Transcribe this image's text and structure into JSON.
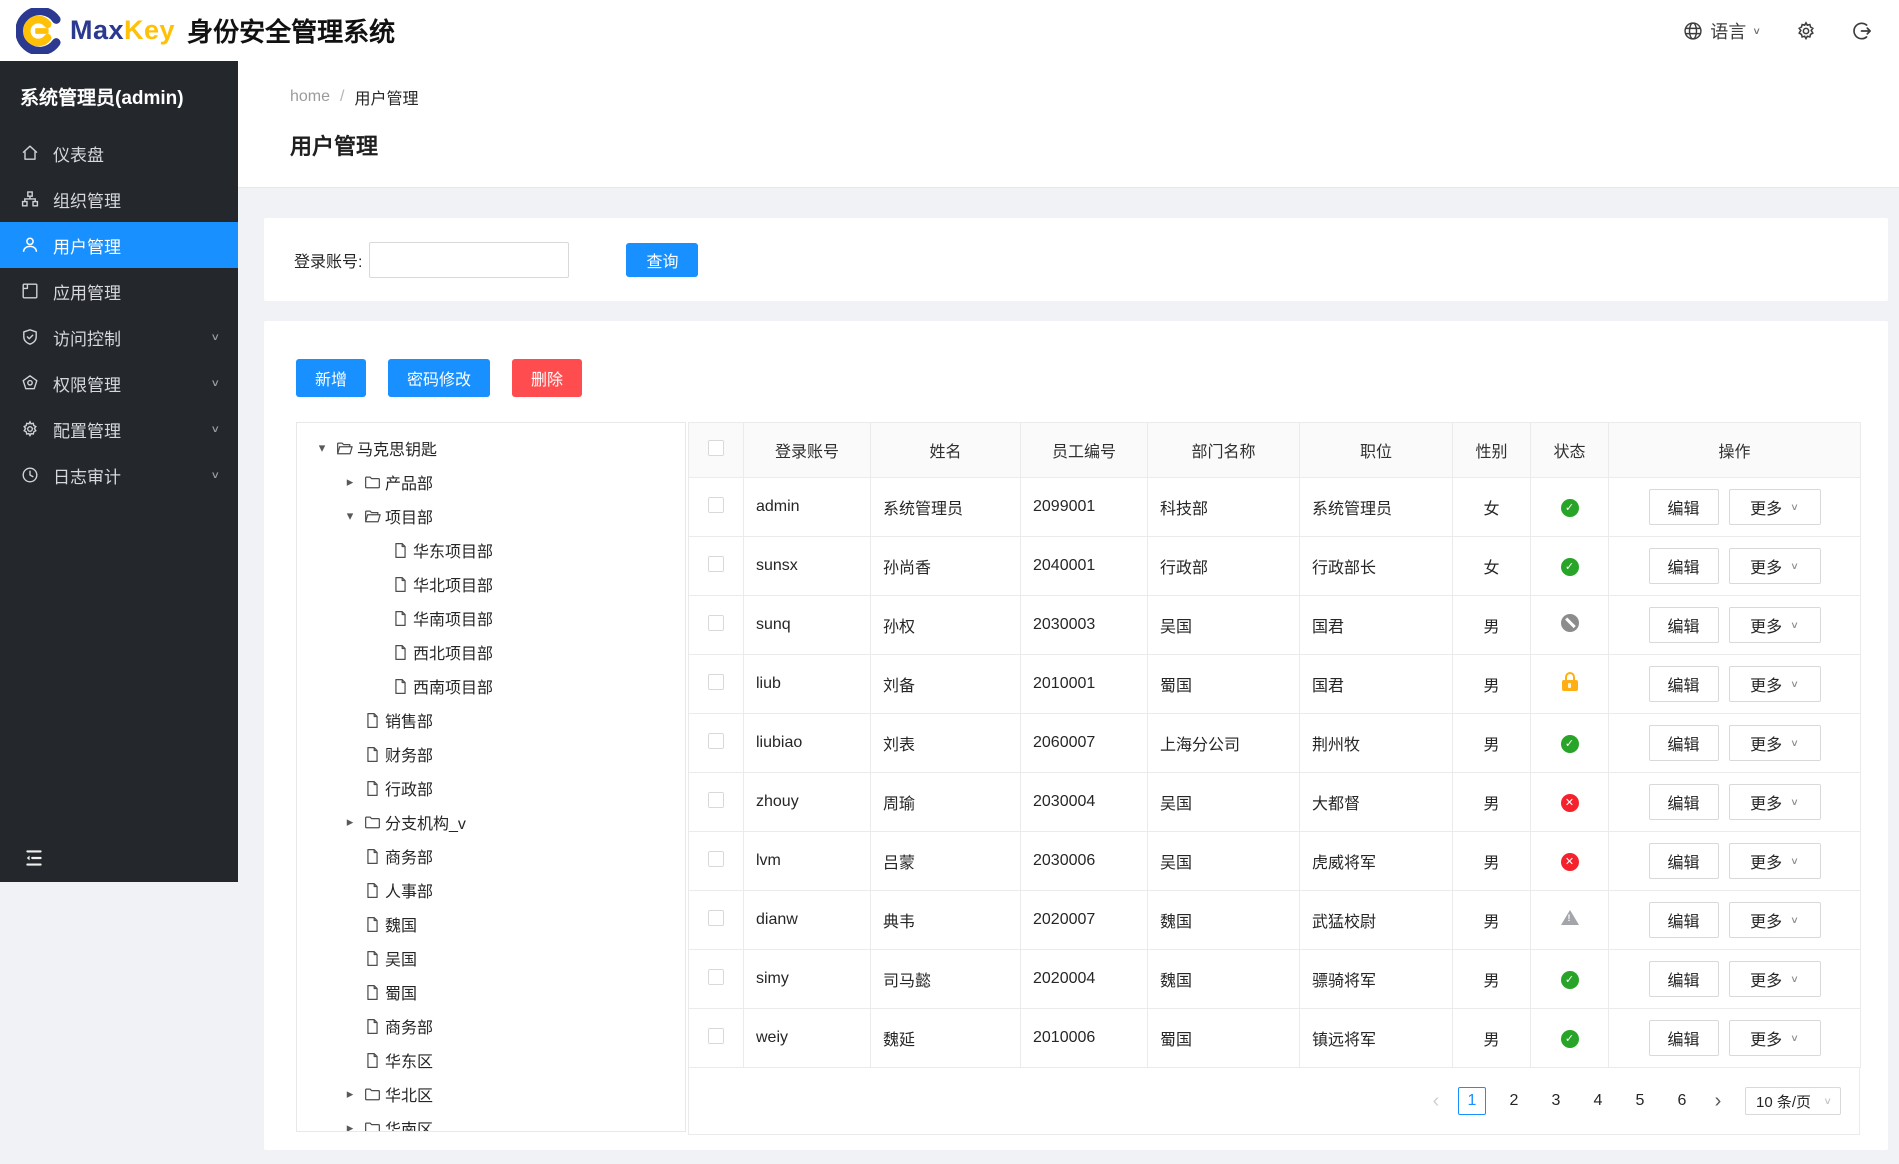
{
  "header": {
    "brand_max": "Max",
    "brand_key": "Key",
    "brand_title": "身份安全管理系统",
    "language_label": "语言"
  },
  "sidebar": {
    "user_label": "系统管理员(admin)",
    "items": [
      {
        "label": "仪表盘",
        "icon": "dashboard-icon",
        "active": false,
        "expandable": false
      },
      {
        "label": "组织管理",
        "icon": "org-icon",
        "active": false,
        "expandable": false
      },
      {
        "label": "用户管理",
        "icon": "user-icon",
        "active": true,
        "expandable": false
      },
      {
        "label": "应用管理",
        "icon": "app-icon",
        "active": false,
        "expandable": false
      },
      {
        "label": "访问控制",
        "icon": "shield-icon",
        "active": false,
        "expandable": true
      },
      {
        "label": "权限管理",
        "icon": "gem-icon",
        "active": false,
        "expandable": true
      },
      {
        "label": "配置管理",
        "icon": "gear-icon",
        "active": false,
        "expandable": true
      },
      {
        "label": "日志审计",
        "icon": "clock-icon",
        "active": false,
        "expandable": true
      }
    ]
  },
  "breadcrumb": {
    "home": "home",
    "separator": "/",
    "current": "用户管理"
  },
  "page": {
    "title": "用户管理"
  },
  "search": {
    "label": "登录账号:",
    "value": "",
    "button": "查询"
  },
  "toolbar": {
    "add": "新增",
    "modify_password": "密码修改",
    "delete": "删除"
  },
  "tree": {
    "items": [
      {
        "label": "马克思钥匙",
        "level": 0,
        "node": "folder-open",
        "caret": "down"
      },
      {
        "label": "产品部",
        "level": 1,
        "node": "folder",
        "caret": "right"
      },
      {
        "label": "项目部",
        "level": 1,
        "node": "folder-open",
        "caret": "down"
      },
      {
        "label": "华东项目部",
        "level": 2,
        "node": "file",
        "caret": "none"
      },
      {
        "label": "华北项目部",
        "level": 2,
        "node": "file",
        "caret": "none"
      },
      {
        "label": "华南项目部",
        "level": 2,
        "node": "file",
        "caret": "none"
      },
      {
        "label": "西北项目部",
        "level": 2,
        "node": "file",
        "caret": "none"
      },
      {
        "label": "西南项目部",
        "level": 2,
        "node": "file",
        "caret": "none"
      },
      {
        "label": "销售部",
        "level": 1,
        "node": "file",
        "caret": "none"
      },
      {
        "label": "财务部",
        "level": 1,
        "node": "file",
        "caret": "none"
      },
      {
        "label": "行政部",
        "level": 1,
        "node": "file",
        "caret": "none"
      },
      {
        "label": "分支机构_v",
        "level": 1,
        "node": "folder",
        "caret": "right"
      },
      {
        "label": "商务部",
        "level": 1,
        "node": "file",
        "caret": "none"
      },
      {
        "label": "人事部",
        "level": 1,
        "node": "file",
        "caret": "none"
      },
      {
        "label": "魏国",
        "level": 1,
        "node": "file",
        "caret": "none"
      },
      {
        "label": "吴国",
        "level": 1,
        "node": "file",
        "caret": "none"
      },
      {
        "label": "蜀国",
        "level": 1,
        "node": "file",
        "caret": "none"
      },
      {
        "label": "商务部",
        "level": 1,
        "node": "file",
        "caret": "none"
      },
      {
        "label": "华东区",
        "level": 1,
        "node": "file",
        "caret": "none"
      },
      {
        "label": "华北区",
        "level": 1,
        "node": "folder",
        "caret": "right"
      },
      {
        "label": "华南区",
        "level": 1,
        "node": "folder",
        "caret": "right"
      }
    ]
  },
  "table": {
    "columns": [
      "登录账号",
      "姓名",
      "员工编号",
      "部门名称",
      "职位",
      "性别",
      "状态",
      "操作"
    ],
    "rows": [
      {
        "account": "admin",
        "name": "系统管理员",
        "emp_no": "2099001",
        "dept": "科技部",
        "title": "系统管理员",
        "gender": "女",
        "status": "active"
      },
      {
        "account": "sunsx",
        "name": "孙尚香",
        "emp_no": "2040001",
        "dept": "行政部",
        "title": "行政部长",
        "gender": "女",
        "status": "active"
      },
      {
        "account": "sunq",
        "name": "孙权",
        "emp_no": "2030003",
        "dept": "吴国",
        "title": "国君",
        "gender": "男",
        "status": "banned"
      },
      {
        "account": "liub",
        "name": "刘备",
        "emp_no": "2010001",
        "dept": "蜀国",
        "title": "国君",
        "gender": "男",
        "status": "locked"
      },
      {
        "account": "liubiao",
        "name": "刘表",
        "emp_no": "2060007",
        "dept": "上海分公司",
        "title": "荆州牧",
        "gender": "男",
        "status": "active"
      },
      {
        "account": "zhouy",
        "name": "周瑜",
        "emp_no": "2030004",
        "dept": "吴国",
        "title": "大都督",
        "gender": "男",
        "status": "inactive"
      },
      {
        "account": "lvm",
        "name": "吕蒙",
        "emp_no": "2030006",
        "dept": "吴国",
        "title": "虎威将军",
        "gender": "男",
        "status": "inactive"
      },
      {
        "account": "dianw",
        "name": "典韦",
        "emp_no": "2020007",
        "dept": "魏国",
        "title": "武猛校尉",
        "gender": "男",
        "status": "warning"
      },
      {
        "account": "simy",
        "name": "司马懿",
        "emp_no": "2020004",
        "dept": "魏国",
        "title": "骠骑将军",
        "gender": "男",
        "status": "active"
      },
      {
        "account": "weiy",
        "name": "魏延",
        "emp_no": "2010006",
        "dept": "蜀国",
        "title": "镇远将军",
        "gender": "男",
        "status": "active"
      }
    ],
    "actions": {
      "edit": "编辑",
      "more": "更多"
    }
  },
  "pagination": {
    "prev": "‹",
    "next": "›",
    "pages": [
      "1",
      "2",
      "3",
      "4",
      "5",
      "6"
    ],
    "current": "1",
    "page_size": "10 条/页"
  },
  "colors": {
    "accent": "#1890ff",
    "danger": "#ff4d4f",
    "status_active": "#28a428",
    "status_inactive": "#f5222d",
    "status_banned": "#8c8c8c",
    "status_locked": "#ffaf14",
    "sidebar_bg": "#24272c"
  }
}
